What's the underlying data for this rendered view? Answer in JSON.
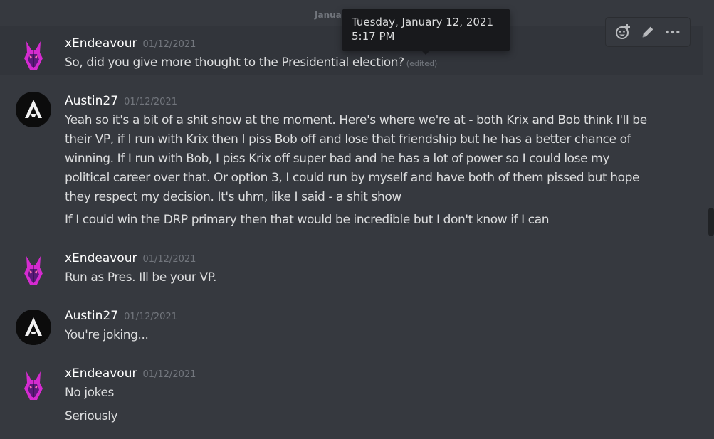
{
  "divider": {
    "label": "Janua"
  },
  "tooltip": {
    "date": "Tuesday, January 12, 2021",
    "time": "5:17 PM"
  },
  "colors": {
    "background": "#36393f",
    "username": "#ffffff",
    "timestamp": "#72767d",
    "text": "#dcddde",
    "avatar_pink": "#d52bd0",
    "avatar_dark": "#0c0c0c"
  },
  "toolbar": {
    "icons": [
      "add-reaction-icon",
      "edit-pencil-icon",
      "more-options-icon"
    ]
  },
  "messages": [
    {
      "author": "xEndeavour",
      "timestamp": "01/12/2021",
      "lines": [
        "So, did you give more thought to the Presidential election?"
      ],
      "edited": "(edited)"
    },
    {
      "author": "Austin27",
      "timestamp": "01/12/2021",
      "lines": [
        "Yeah so it's a bit of a shit show at the moment. Here's where we're at - both Krix and Bob think I'll be",
        "their VP, if I run with Krix then I piss Bob off and lose that friendship but he has a better chance of",
        "winning. If I run with Bob, I piss Krix off super bad and he has a lot of power so I could lose my",
        "political career over that. Or option 3, I could run by myself and have both of them pissed but hope",
        "they respect my decision. It's uhm, like I said - a shit show",
        "If I could win the DRP primary then that would be incredible but I don't know if I can"
      ]
    },
    {
      "author": "xEndeavour",
      "timestamp": "01/12/2021",
      "lines": [
        "Run as Pres. Ill be your VP."
      ]
    },
    {
      "author": "Austin27",
      "timestamp": "01/12/2021",
      "lines": [
        "You're joking..."
      ]
    },
    {
      "author": "xEndeavour",
      "timestamp": "01/12/2021",
      "lines": [
        "No jokes",
        "Seriously"
      ]
    }
  ]
}
